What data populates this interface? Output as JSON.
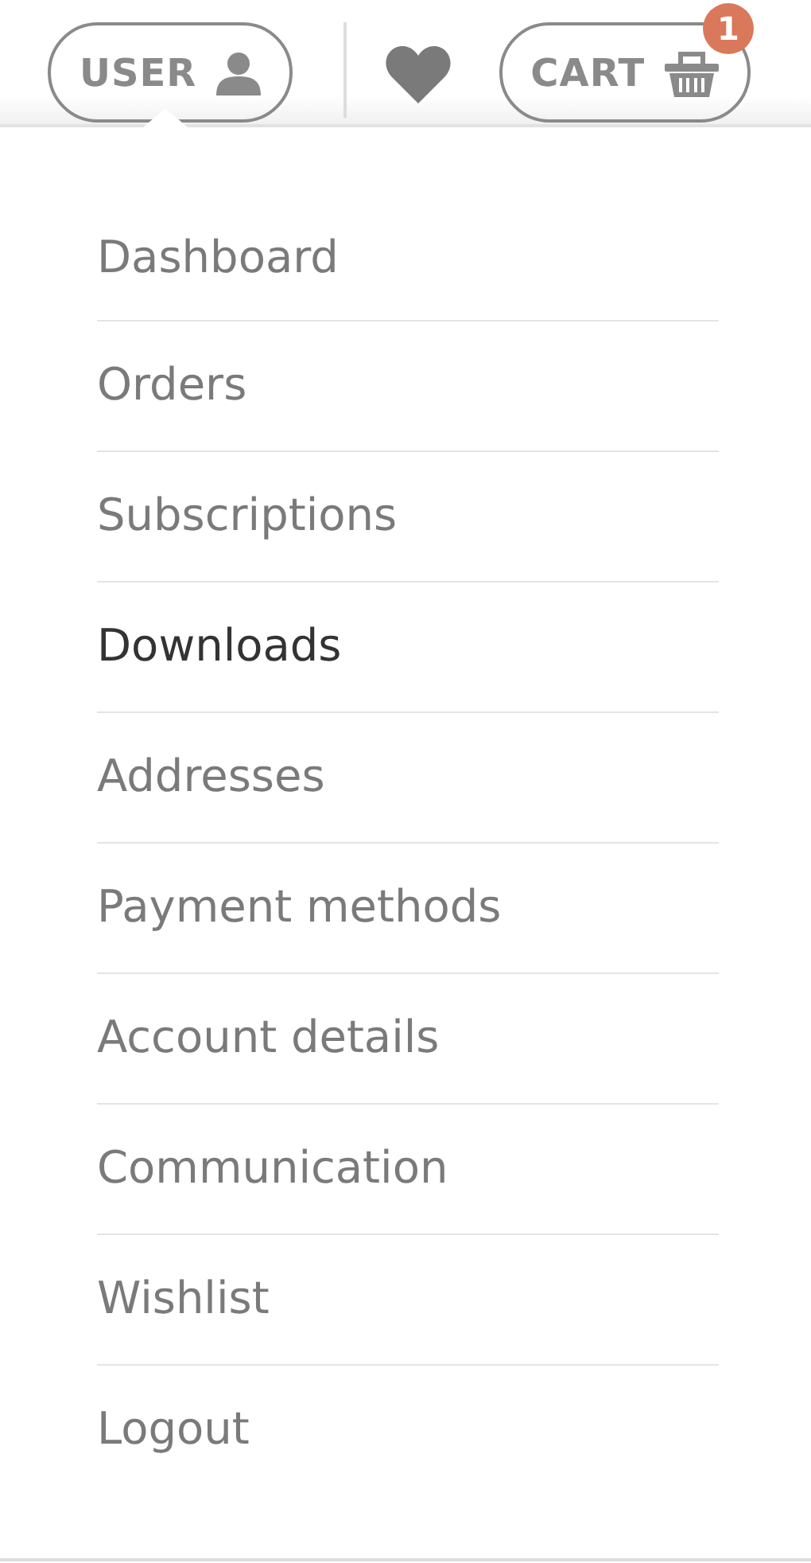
{
  "header": {
    "user_button": "USER",
    "cart_button": "CART",
    "cart_count": "1"
  },
  "menu": {
    "items": [
      {
        "label": "Dashboard",
        "selected": false
      },
      {
        "label": "Orders",
        "selected": false
      },
      {
        "label": "Subscriptions",
        "selected": false
      },
      {
        "label": "Downloads",
        "selected": true
      },
      {
        "label": "Addresses",
        "selected": false
      },
      {
        "label": "Payment methods",
        "selected": false
      },
      {
        "label": "Account details",
        "selected": false
      },
      {
        "label": "Communication",
        "selected": false
      },
      {
        "label": "Wishlist",
        "selected": false
      },
      {
        "label": "Logout",
        "selected": false
      }
    ]
  }
}
